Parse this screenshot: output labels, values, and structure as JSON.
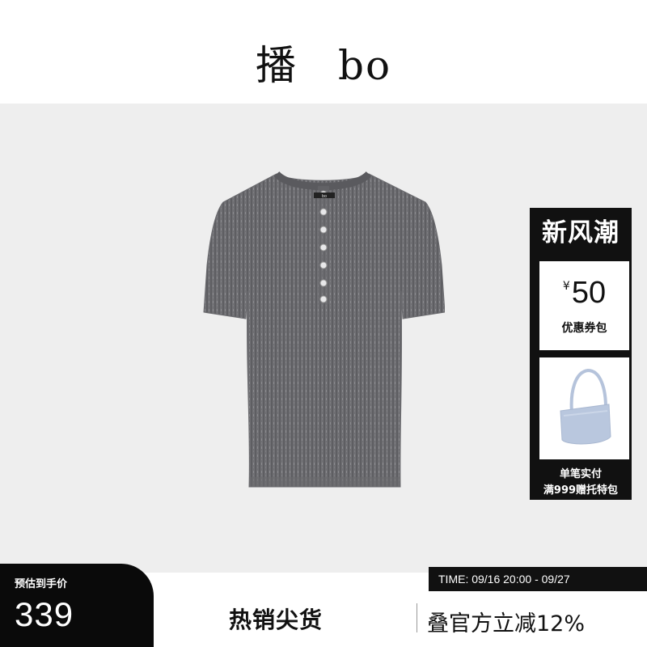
{
  "header": {
    "brand_char": "播",
    "brand_latin": "bo"
  },
  "product": {
    "label_text": "bo"
  },
  "promo": {
    "title": "新风潮",
    "coupon": {
      "currency": "¥",
      "amount": "50",
      "label": "优惠券包"
    },
    "gift": {
      "line1": "单笔实付",
      "line2": "满999赠托特包"
    }
  },
  "price": {
    "label": "预估到手价",
    "value": "339"
  },
  "time": {
    "text": "TIME: 09/16 20:00 - 09/27"
  },
  "footer": {
    "hot": "热销尖货",
    "discount": "叠官方立减12%"
  },
  "colors": {
    "accent": "#111111",
    "background": "#eeeeee",
    "knit": "#6f6f72",
    "bag": "#b9c7de"
  }
}
